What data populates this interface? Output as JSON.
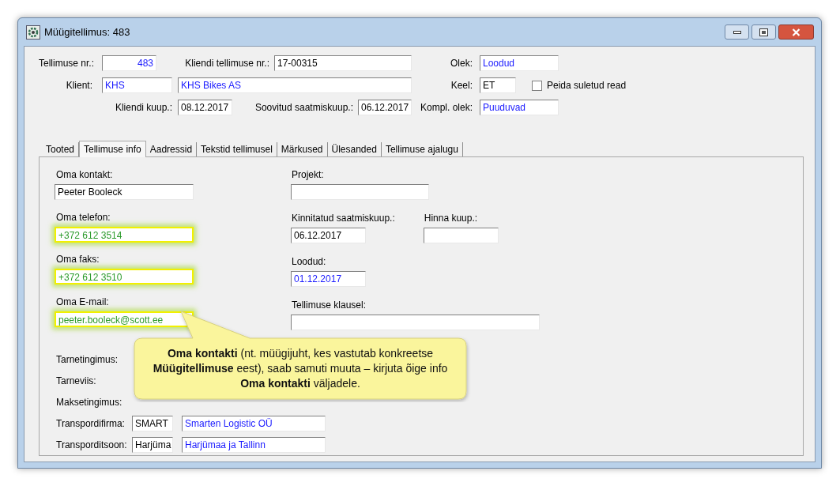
{
  "window": {
    "title": "Müügitellimus: 483"
  },
  "header_rows": [
    [
      {
        "label": "Tellimuse nr.:",
        "fields": [
          {
            "value": "483",
            "kind": "number"
          }
        ]
      },
      {
        "label": "Kliendi tellimuse nr.:",
        "fields": [
          {
            "value": "17-00315",
            "kind": "text"
          }
        ]
      },
      {
        "label": "Olek:",
        "fields": [
          {
            "value": "Loodud",
            "kind": "lookup"
          }
        ]
      }
    ],
    [
      {
        "label": "Klient:",
        "fields": [
          {
            "value": "KHS",
            "kind": "lookup"
          },
          {
            "value": "KHS Bikes AS",
            "kind": "lookup"
          }
        ]
      },
      {
        "label": "Keel:",
        "fields": [
          {
            "value": "ET",
            "kind": "text"
          }
        ]
      },
      {
        "label": "Peida suletud read",
        "kind": "checkbox",
        "checked": false
      }
    ],
    [
      {
        "label": "Kliendi kuup.:",
        "fields": [
          {
            "value": "08.12.2017",
            "kind": "text"
          }
        ]
      },
      {
        "label": "Soovitud saatmiskuup.:",
        "fields": [
          {
            "value": "06.12.2017",
            "kind": "text"
          }
        ]
      },
      {
        "label": "Kompl. olek:",
        "fields": [
          {
            "value": "Puuduvad",
            "kind": "lookup"
          }
        ]
      }
    ]
  ],
  "tabs": [
    {
      "label": "Tooted",
      "selected": false
    },
    {
      "label": "Tellimuse info",
      "selected": true
    },
    {
      "label": "Aadressid",
      "selected": false
    },
    {
      "label": "Tekstid tellimusel",
      "selected": false
    },
    {
      "label": "Märkused",
      "selected": false
    },
    {
      "label": "Ülesanded",
      "selected": false
    },
    {
      "label": "Tellimuse ajalugu",
      "selected": false
    }
  ],
  "contact_fields": [
    {
      "label": "Oma kontakt:",
      "value": "Peeter Booleck",
      "highlighted": false
    },
    {
      "label": "Oma telefon:",
      "value": "+372 612 3514",
      "highlighted": true
    },
    {
      "label": "Oma faks:",
      "value": "+372 612 3510",
      "highlighted": true
    },
    {
      "label": "Oma E-mail:",
      "value": "peeter.booleck@scott.ee",
      "highlighted": true
    }
  ],
  "delivery_rows": [
    {
      "label": "Tarnetingimus:"
    },
    {
      "label": "Tarneviis:"
    },
    {
      "label": "Maksetingimus:"
    },
    {
      "label": "Transpordifirma:",
      "fields": [
        {
          "value": "SMART",
          "kind": "text"
        },
        {
          "value": "Smarten Logistic OÜ",
          "kind": "lookup"
        }
      ]
    },
    {
      "label": "Transporditsoon:",
      "fields": [
        {
          "value": "Harjüma",
          "kind": "text"
        },
        {
          "value": "Harjümaa ja Tallinn",
          "kind": "lookup"
        }
      ]
    }
  ],
  "right_rows": [
    {
      "items": [
        {
          "label": "Projekt:"
        }
      ]
    },
    {
      "items": [
        {
          "label": "Kinnitatud saatmiskuup.:",
          "value": "06.12.2017",
          "kind": "text"
        },
        {
          "label": "Hinna kuup.:"
        }
      ]
    },
    {
      "items": [
        {
          "label": "Loodud:",
          "value": "01.12.2017",
          "kind": "lookup"
        }
      ]
    },
    {
      "items": [
        {
          "label": "Tellimuse klausel:"
        }
      ]
    }
  ],
  "callout": {
    "text": "**Oma kontakti** (nt. müügijuht, kes vastutab konkreetse **Müügitellimuse** eest), saab samuti muuta – kirjuta õige info **Oma kontakti** väljadele."
  }
}
